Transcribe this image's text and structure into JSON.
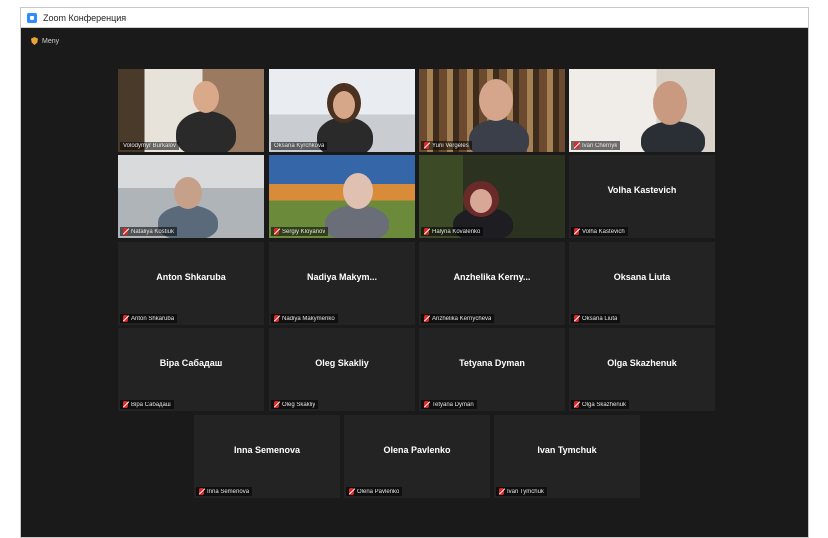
{
  "window": {
    "title": "Zoom Конференция"
  },
  "security": {
    "label": "Meny"
  },
  "participants": [
    {
      "name": "Volodymyr Burkalov",
      "label": "Volodymyr Burkalov",
      "video": true,
      "active": true
    },
    {
      "name": "Oksana Kyrchkova",
      "label": "Oksana Kyrchkova",
      "video": true
    },
    {
      "name": "Yurii Vergeles",
      "label": "Yurii Vergeles",
      "video": true
    },
    {
      "name": "Ivan Chernyk",
      "label": "Ivan Chernyk",
      "video": true
    },
    {
      "name": "Nataliya Kostiuk",
      "label": "Nataliya Kostiuk",
      "video": true
    },
    {
      "name": "Sergiy Kloyanov",
      "label": "Sergiy Kloyanov",
      "video": true
    },
    {
      "name": "Halyna Kovalenko",
      "label": "Halyna Kovalenko",
      "video": true
    },
    {
      "name": "Volha Kastevich",
      "label": "Volha Kastevich",
      "video": false
    },
    {
      "name": "Anton Shkaruba",
      "label": "Anton Shkaruba",
      "video": false
    },
    {
      "name": "Nadiya Makym...",
      "label": "Nadiya Makymenko",
      "video": false
    },
    {
      "name": "Anzhelika Kerny...",
      "label": "Anzhelika Kernycheva",
      "video": false
    },
    {
      "name": "Oksana Liuta",
      "label": "Oksana Liuta",
      "video": false
    },
    {
      "name": "Віра Сабадаш",
      "label": "Віра Сабадаш",
      "video": false
    },
    {
      "name": "Oleg Skakliy",
      "label": "Oleg Skakliy",
      "video": false
    },
    {
      "name": "Tetyana Dyman",
      "label": "Tetyana Dyman",
      "video": false
    },
    {
      "name": "Olga Skazhenuk",
      "label": "Olga Skazhenuk",
      "video": false
    },
    {
      "name": "Inna Semenova",
      "label": "Inna Semenova",
      "video": false
    },
    {
      "name": "Olena Pavlenko",
      "label": "Olena Pavlenko",
      "video": false
    },
    {
      "name": "Ivan Tymchuk",
      "label": "Ivan Tymchuk",
      "video": false
    }
  ],
  "colors": {
    "background": "#1a1a1a",
    "tile": "#232323",
    "active_border": "#c6e05a",
    "muted_mic": "#e02828"
  }
}
